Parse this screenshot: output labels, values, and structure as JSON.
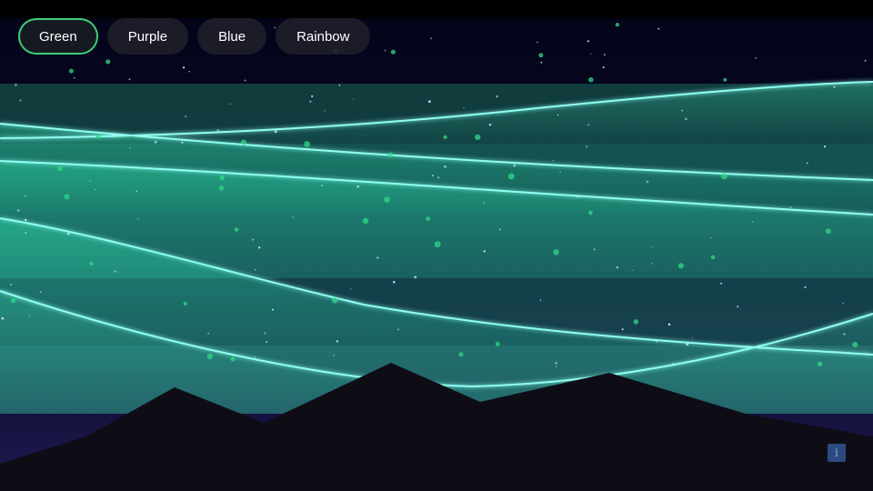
{
  "controls": {
    "buttons": [
      {
        "label": "Green",
        "active": true
      },
      {
        "label": "Purple",
        "active": false
      },
      {
        "label": "Blue",
        "active": false
      },
      {
        "label": "Rainbow",
        "active": false
      }
    ]
  },
  "info_button": {
    "label": "i"
  },
  "theme": {
    "accent": "#3fcf7a",
    "aurora_core": "#2fe6b0",
    "aurora_edge": "#8ffff0",
    "mountain": "#0e0d16",
    "sky_top": "#04041a",
    "sky_bottom": "#1f1a50"
  }
}
